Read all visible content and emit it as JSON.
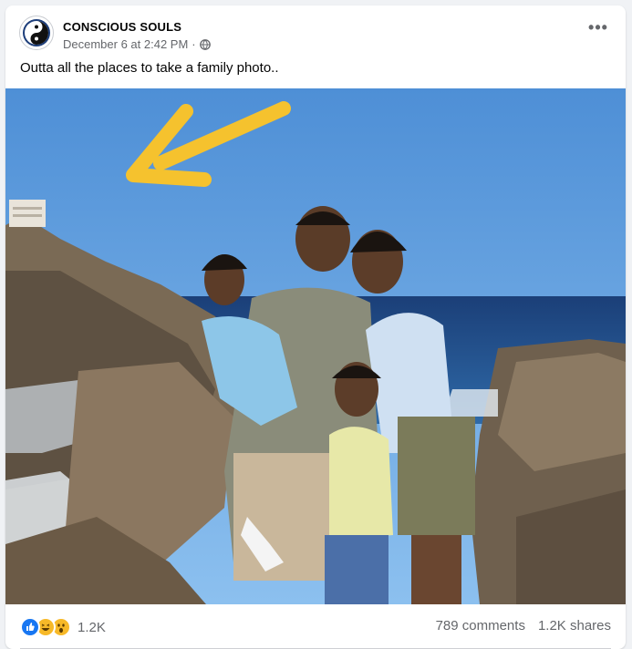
{
  "post": {
    "page_name": "CONSCIOUS SOULS",
    "timestamp": "December 6 at 2:42 PM",
    "separator": "·",
    "audience_icon": "globe-icon",
    "more_icon": "more-options-icon",
    "more_label": "•••",
    "text": "Outta all the places to take a family photo.."
  },
  "photo": {
    "subject": "family photo on seaside cliffs",
    "annotation_icon": "yellow-arrow-icon",
    "colors": {
      "sky": "#5b9ee0",
      "arrow": "#f5c22e",
      "ocean": "#1e4a86"
    }
  },
  "engagement": {
    "reaction_icons": [
      "like-reaction-icon",
      "haha-reaction-icon",
      "wow-reaction-icon"
    ],
    "reaction_count": "1.2K",
    "comments": "789 comments",
    "shares": "1.2K shares"
  }
}
